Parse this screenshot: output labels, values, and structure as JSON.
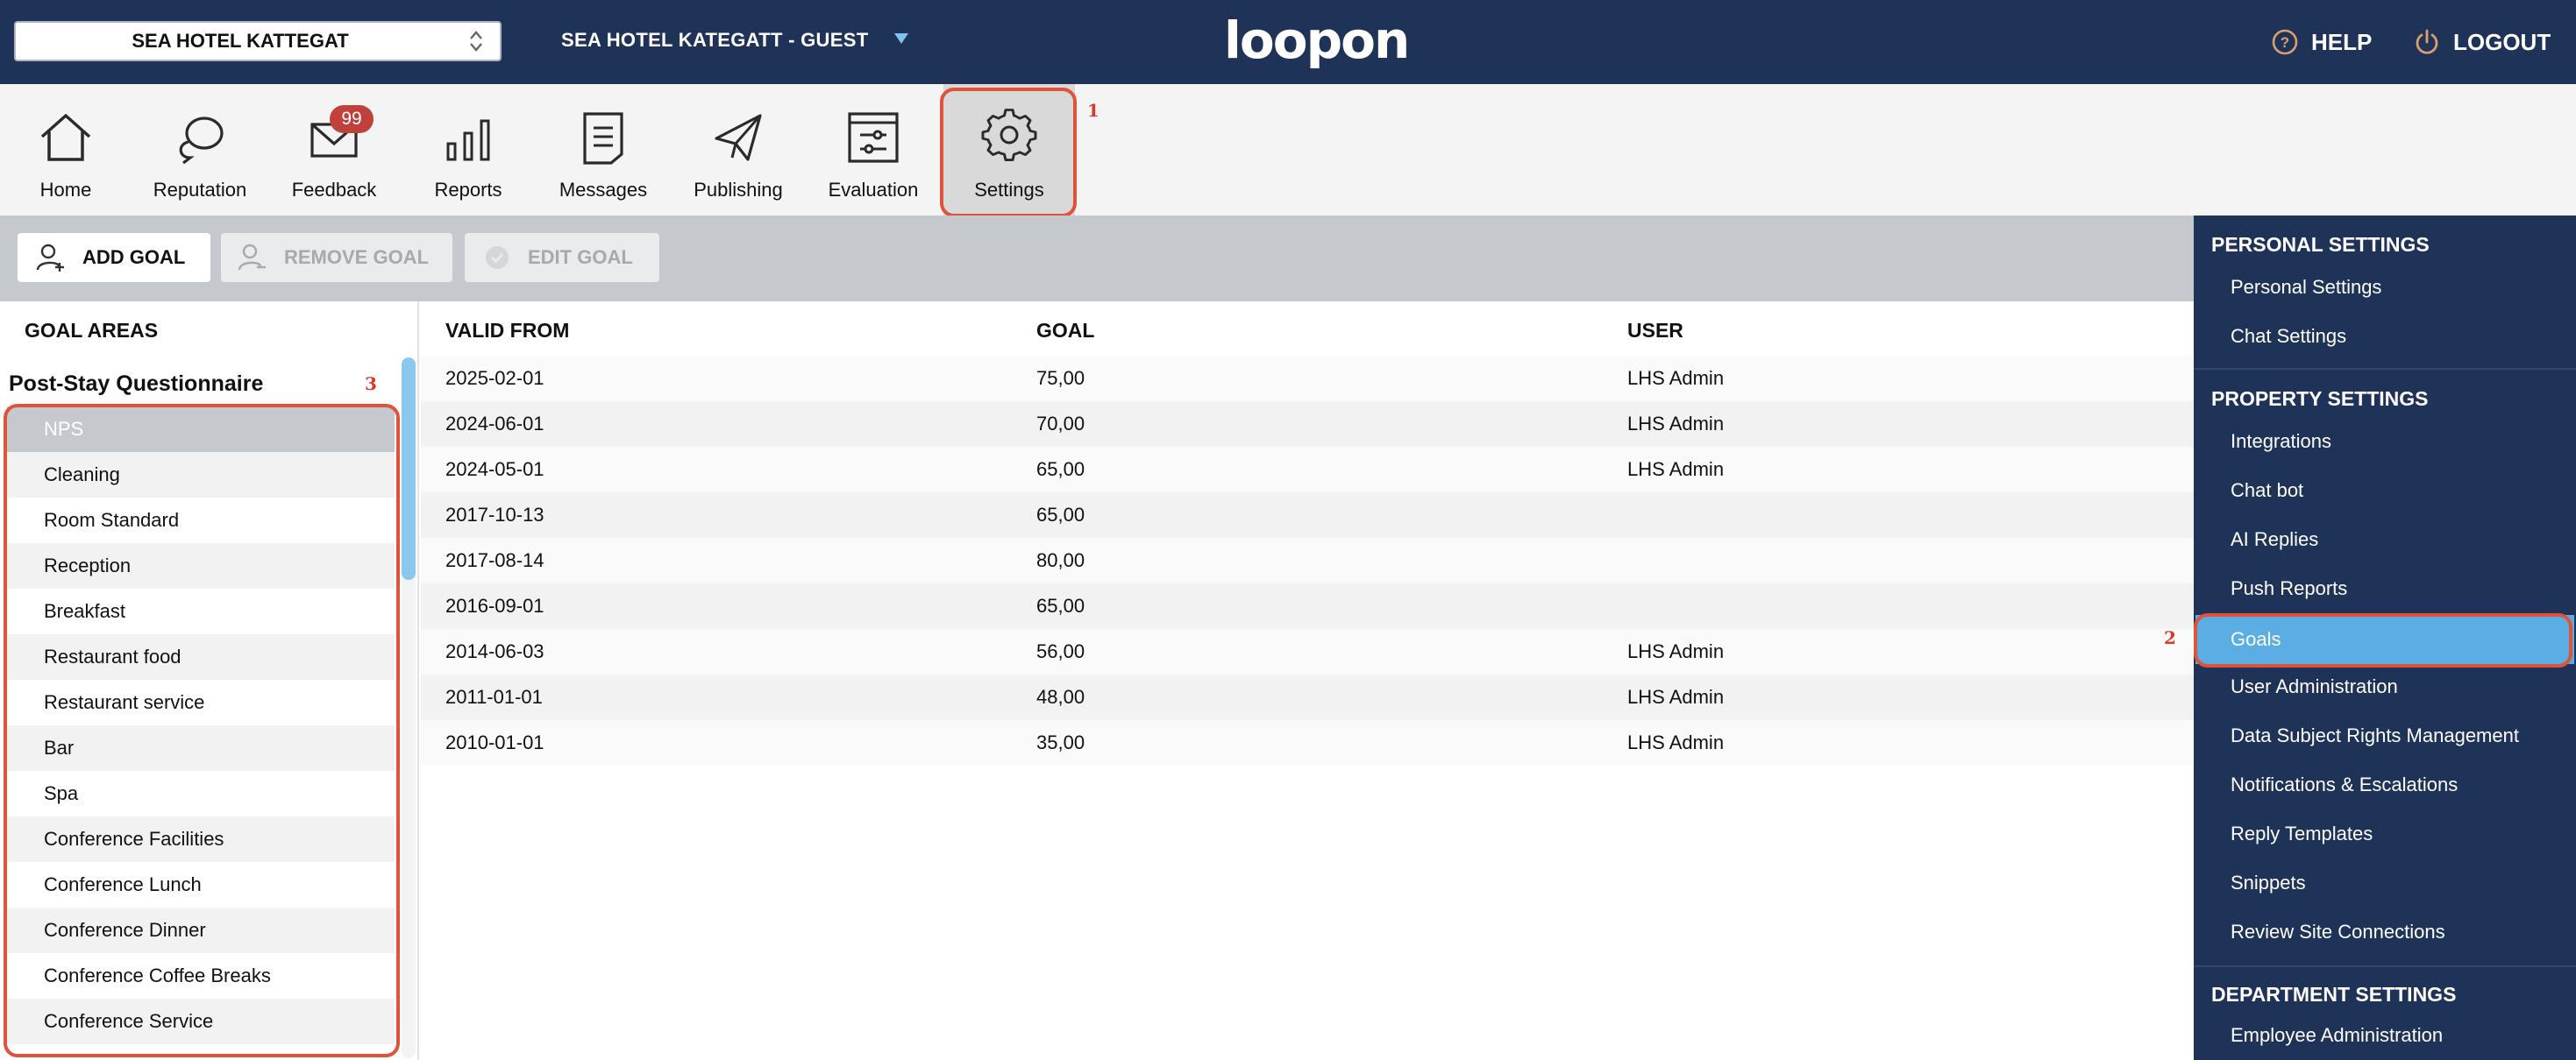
{
  "header": {
    "property_selector": "SEA HOTEL KATTEGAT",
    "guest_selector": "SEA HOTEL KATEGATT - GUEST",
    "logo": "loopon",
    "help_label": "HELP",
    "logout_label": "LOGOUT"
  },
  "nav": {
    "items": [
      {
        "label": "Home",
        "icon": "home-icon"
      },
      {
        "label": "Reputation",
        "icon": "chat-bubbles-icon"
      },
      {
        "label": "Feedback",
        "icon": "envelope-icon"
      },
      {
        "label": "Reports",
        "icon": "bar-chart-icon"
      },
      {
        "label": "Messages",
        "icon": "document-icon"
      },
      {
        "label": "Publishing",
        "icon": "paper-plane-icon"
      },
      {
        "label": "Evaluation",
        "icon": "sliders-icon"
      },
      {
        "label": "Settings",
        "icon": "gear-icon"
      }
    ],
    "feedback_badge": "99",
    "active": "Settings"
  },
  "annotations": {
    "one": "1",
    "two": "2",
    "three": "3"
  },
  "toolbar": {
    "add_goal": "ADD GOAL",
    "remove_goal": "REMOVE GOAL",
    "edit_goal": "EDIT GOAL"
  },
  "goal_areas": {
    "header": "GOAL AREAS",
    "group": "Post-Stay Questionnaire",
    "items": [
      "NPS",
      "Cleaning",
      "Room Standard",
      "Reception",
      "Breakfast",
      "Restaurant food",
      "Restaurant service",
      "Bar",
      "Spa",
      "Conference Facilities",
      "Conference Lunch",
      "Conference Dinner",
      "Conference Coffee Breaks",
      "Conference Service"
    ],
    "selected": "NPS"
  },
  "goals_table": {
    "columns": {
      "valid_from": "VALID FROM",
      "goal": "GOAL",
      "user": "USER"
    },
    "rows": [
      {
        "valid_from": "2025-02-01",
        "goal": "75,00",
        "user": "LHS Admin"
      },
      {
        "valid_from": "2024-06-01",
        "goal": "70,00",
        "user": "LHS Admin"
      },
      {
        "valid_from": "2024-05-01",
        "goal": "65,00",
        "user": "LHS Admin"
      },
      {
        "valid_from": "2017-10-13",
        "goal": "65,00",
        "user": ""
      },
      {
        "valid_from": "2017-08-14",
        "goal": "80,00",
        "user": ""
      },
      {
        "valid_from": "2016-09-01",
        "goal": "65,00",
        "user": ""
      },
      {
        "valid_from": "2014-06-03",
        "goal": "56,00",
        "user": "LHS Admin"
      },
      {
        "valid_from": "2011-01-01",
        "goal": "48,00",
        "user": "LHS Admin"
      },
      {
        "valid_from": "2010-01-01",
        "goal": "35,00",
        "user": "LHS Admin"
      }
    ]
  },
  "sidebar": {
    "personal": {
      "title": "PERSONAL SETTINGS",
      "items": [
        "Personal Settings",
        "Chat Settings"
      ]
    },
    "property": {
      "title": "PROPERTY SETTINGS",
      "items": [
        "Integrations",
        "Chat bot",
        "AI Replies",
        "Push Reports",
        "Goals",
        "User Administration",
        "Data Subject Rights Management",
        "Notifications & Escalations",
        "Reply Templates",
        "Snippets",
        "Review Site Connections"
      ]
    },
    "department": {
      "title": "DEPARTMENT SETTINGS",
      "items": [
        "Employee Administration"
      ]
    },
    "active": "Goals"
  },
  "colors": {
    "navy": "#1f3359",
    "accent_blue": "#5aaee3",
    "highlight_red": "#e0533a",
    "badge_red": "#c0413b"
  }
}
